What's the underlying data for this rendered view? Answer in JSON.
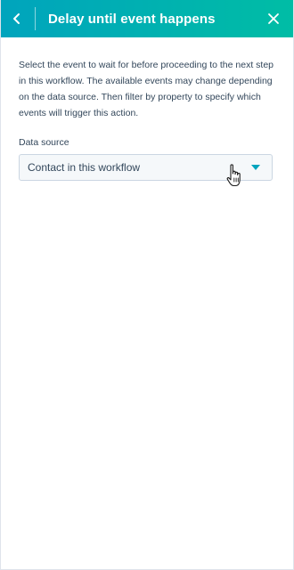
{
  "header": {
    "title": "Delay until event happens",
    "back_icon": "chevron-left-icon",
    "close_icon": "close-icon"
  },
  "body": {
    "description": "Select the event to wait for before proceeding to the next step in this workflow. The available events may change depending on the data source. Then filter by property to specify which events will trigger this action."
  },
  "data_source": {
    "label": "Data source",
    "selected": "Contact in this workflow"
  },
  "colors": {
    "header_gradient_start": "#00a4bd",
    "header_gradient_end": "#00bda5",
    "text": "#33475b",
    "accent": "#00a4bd"
  }
}
